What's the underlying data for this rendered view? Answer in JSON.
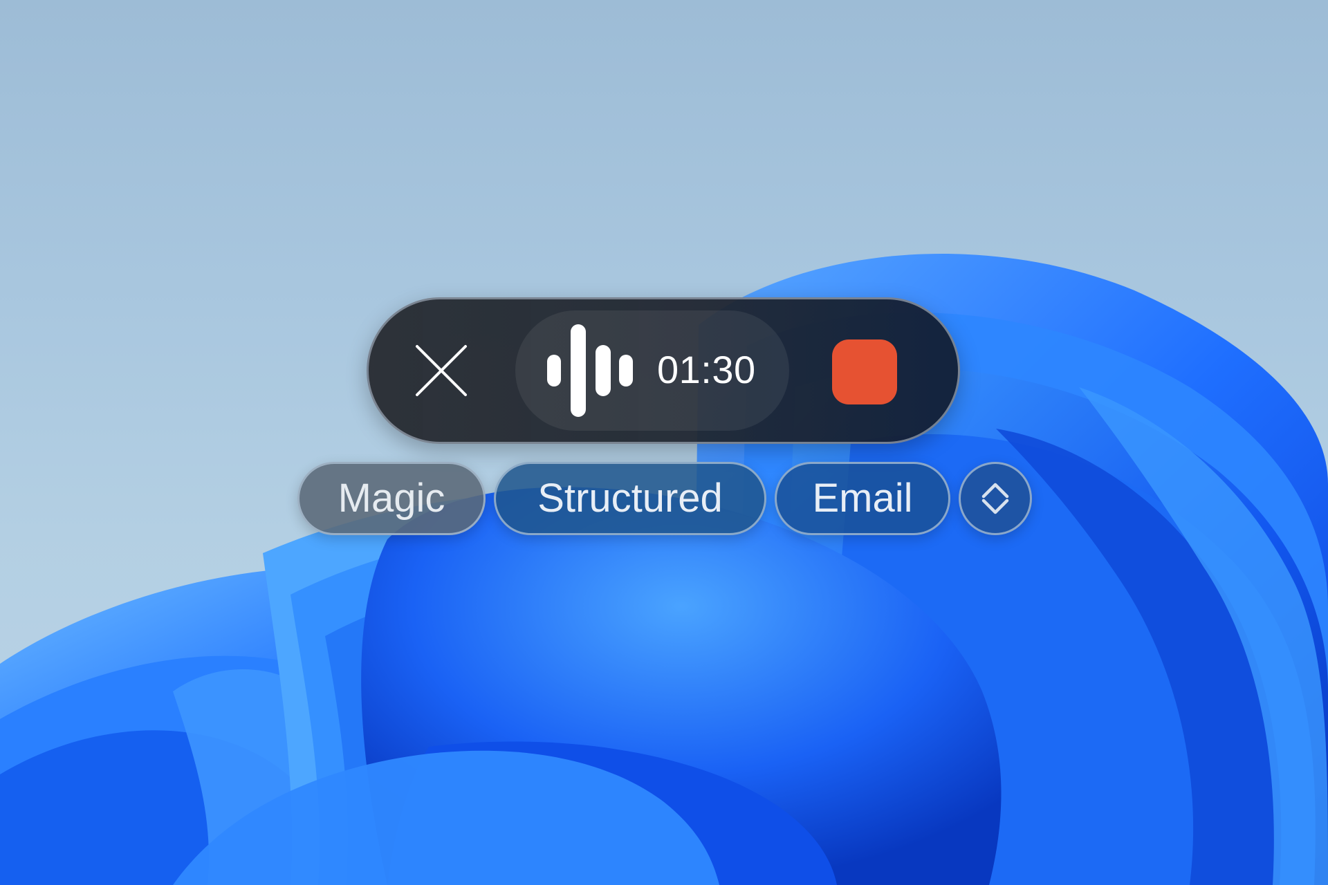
{
  "desktop": {
    "wallpaper": "windows-bloom-wallpaper"
  },
  "recorder": {
    "close_icon": "close-icon",
    "waveform_icon": "audio-waveform-icon",
    "timer": "01:30",
    "stop_icon": "stop-recording-icon",
    "stop_color": "#e65232"
  },
  "modes": {
    "items": [
      {
        "label": "Magic",
        "selected": true
      },
      {
        "label": "Structured",
        "selected": false
      },
      {
        "label": "Email",
        "selected": false
      }
    ],
    "toggle_icon": "chevron-up-down-icon"
  }
}
